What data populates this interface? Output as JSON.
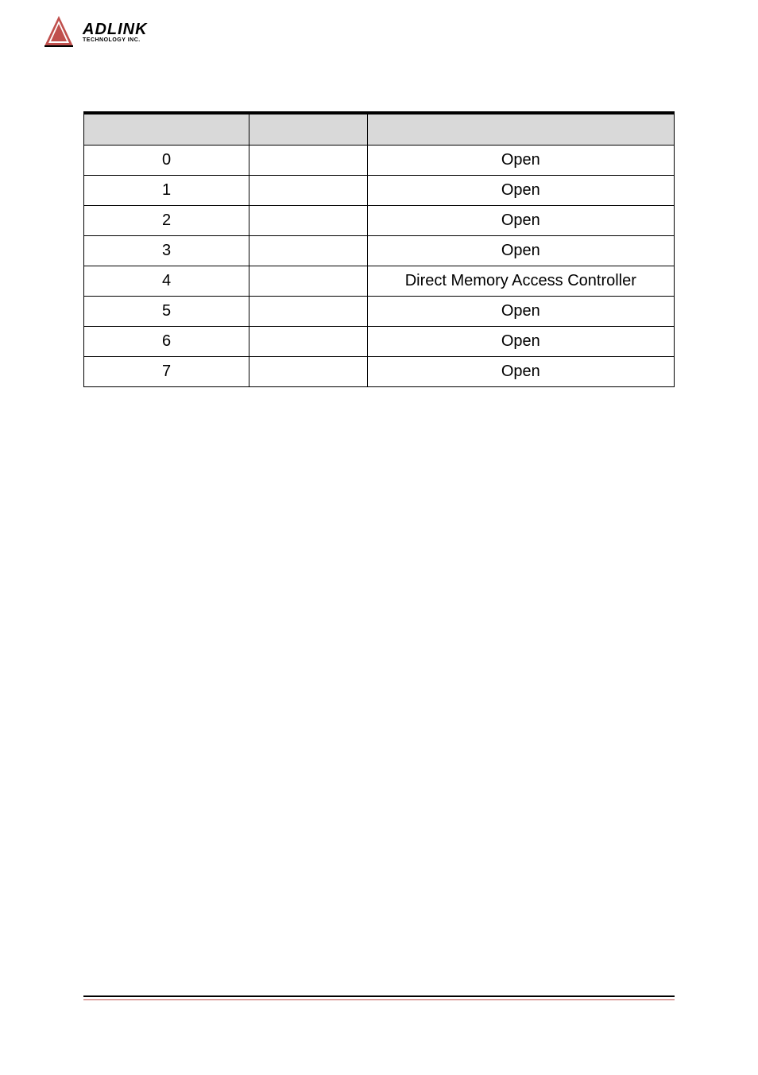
{
  "logo": {
    "main": "ADLINK",
    "sub": "TECHNOLOGY INC."
  },
  "table": {
    "headers": [
      "",
      "",
      ""
    ],
    "rows": [
      {
        "c1": "0",
        "c2": "",
        "c3": "Open"
      },
      {
        "c1": "1",
        "c2": "",
        "c3": "Open"
      },
      {
        "c1": "2",
        "c2": "",
        "c3": "Open"
      },
      {
        "c1": "3",
        "c2": "",
        "c3": "Open"
      },
      {
        "c1": "4",
        "c2": "",
        "c3": "Direct Memory Access Controller"
      },
      {
        "c1": "5",
        "c2": "",
        "c3": "Open"
      },
      {
        "c1": "6",
        "c2": "",
        "c3": "Open"
      },
      {
        "c1": "7",
        "c2": "",
        "c3": "Open"
      }
    ]
  }
}
